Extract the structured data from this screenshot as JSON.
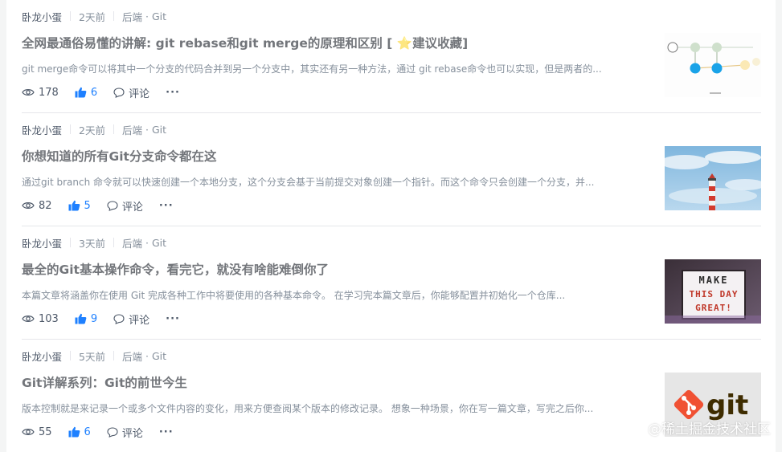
{
  "articles": [
    {
      "author": "卧龙小蛋",
      "time": "2天前",
      "category": "后端",
      "tag": "Git",
      "title": "全网最通俗易懂的讲解: git rebase和git merge的原理和区别 [ ⭐建议收藏]",
      "abstract": "git merge命令可以将其中一个分支的代码合并到另一个分支中，其实还有另一种方法，通过 git rebase命令也可以实现，但是两者的...",
      "views": "178",
      "likes": "6",
      "comment_label": "评论",
      "more": "···",
      "thumb_icon": "git-merge-diagram"
    },
    {
      "author": "卧龙小蛋",
      "time": "2天前",
      "category": "后端",
      "tag": "Git",
      "title": "你想知道的所有Git分支命令都在这",
      "abstract": "通过git branch 命令就可以快速创建一个本地分支，这个分支会基于当前提交对象创建一个指针。而这个命令只会创建一个分支，并...",
      "views": "82",
      "likes": "5",
      "comment_label": "评论",
      "more": "···",
      "thumb_icon": "lighthouse-photo"
    },
    {
      "author": "卧龙小蛋",
      "time": "3天前",
      "category": "后端",
      "tag": "Git",
      "title": "最全的Git基本操作命令，看完它，就没有啥能难倒你了",
      "abstract": "本篇文章将涵盖你在使用 Git 完成各种工作中将要使用的各种基本命令。 在学习完本篇文章后，你能够配置并初始化一个仓库...",
      "views": "103",
      "likes": "9",
      "comment_label": "评论",
      "more": "···",
      "thumb_icon": "lightbox-sign-photo",
      "thumb_text": [
        "MAKE",
        "THIS DAY",
        "GREAT!"
      ]
    },
    {
      "author": "卧龙小蛋",
      "time": "5天前",
      "category": "后端",
      "tag": "Git",
      "title": "Git详解系列：Git的前世今生",
      "abstract": "版本控制就是来记录一个或多个文件内容的变化，用来方便查阅某个版本的修改记录。 想象一种场景，你在写一篇文章，写完之后你...",
      "views": "55",
      "likes": "6",
      "comment_label": "评论",
      "more": "···",
      "thumb_icon": "git-logo",
      "thumb_text": [
        "git"
      ]
    }
  ],
  "watermark": "@稀土掘金技术社区",
  "colors": {
    "accent": "#1e80ff",
    "git_orange": "#f05133"
  }
}
